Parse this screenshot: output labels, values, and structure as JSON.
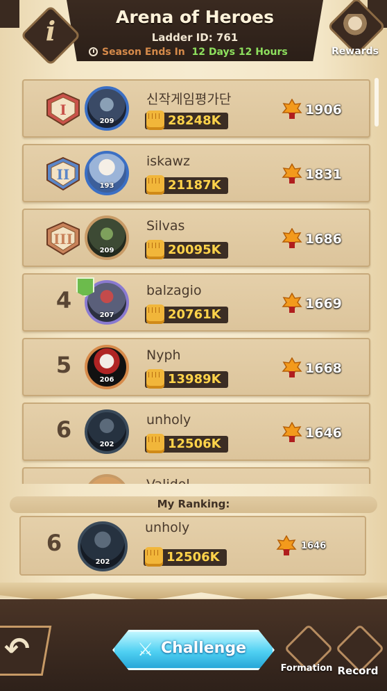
{
  "header": {
    "title": "Arena of Heroes",
    "ladder": "Ladder ID: 761",
    "season_label": "Season Ends In",
    "season_value": "12 Days 12 Hours",
    "info_glyph": "i",
    "rewards_label": "Rewards"
  },
  "rankings": [
    {
      "rank": "",
      "medal": "medal-1",
      "name": "신작게임평가단",
      "level": "209",
      "power": "28248K",
      "score": "1906"
    },
    {
      "rank": "",
      "medal": "medal-2",
      "name": "iskawz",
      "level": "193",
      "power": "21187K",
      "score": "1831"
    },
    {
      "rank": "",
      "medal": "medal-3",
      "name": "Silvas",
      "level": "209",
      "power": "20095K",
      "score": "1686"
    },
    {
      "rank": "4",
      "name": "balzagio",
      "level": "207",
      "power": "20761K",
      "score": "1669"
    },
    {
      "rank": "5",
      "name": "Nyph",
      "level": "206",
      "power": "13989K",
      "score": "1668"
    },
    {
      "rank": "6",
      "name": "unholy",
      "level": "202",
      "power": "12506K",
      "score": "1646"
    },
    {
      "rank": "",
      "name": "Validol",
      "level": "",
      "power": "",
      "score": ""
    }
  ],
  "my_ranking": {
    "label": "My Ranking:",
    "rank": "6",
    "name": "unholy",
    "level": "202",
    "power": "12506K",
    "score": "1646"
  },
  "bottom": {
    "back_glyph": "↶",
    "challenge_label": "Challenge",
    "formation_label": "Formation",
    "record_label": "Record"
  },
  "colors": {
    "power_text": "#ffd34a",
    "season_value": "#8ee05e",
    "challenge": "#4fd0f2"
  }
}
